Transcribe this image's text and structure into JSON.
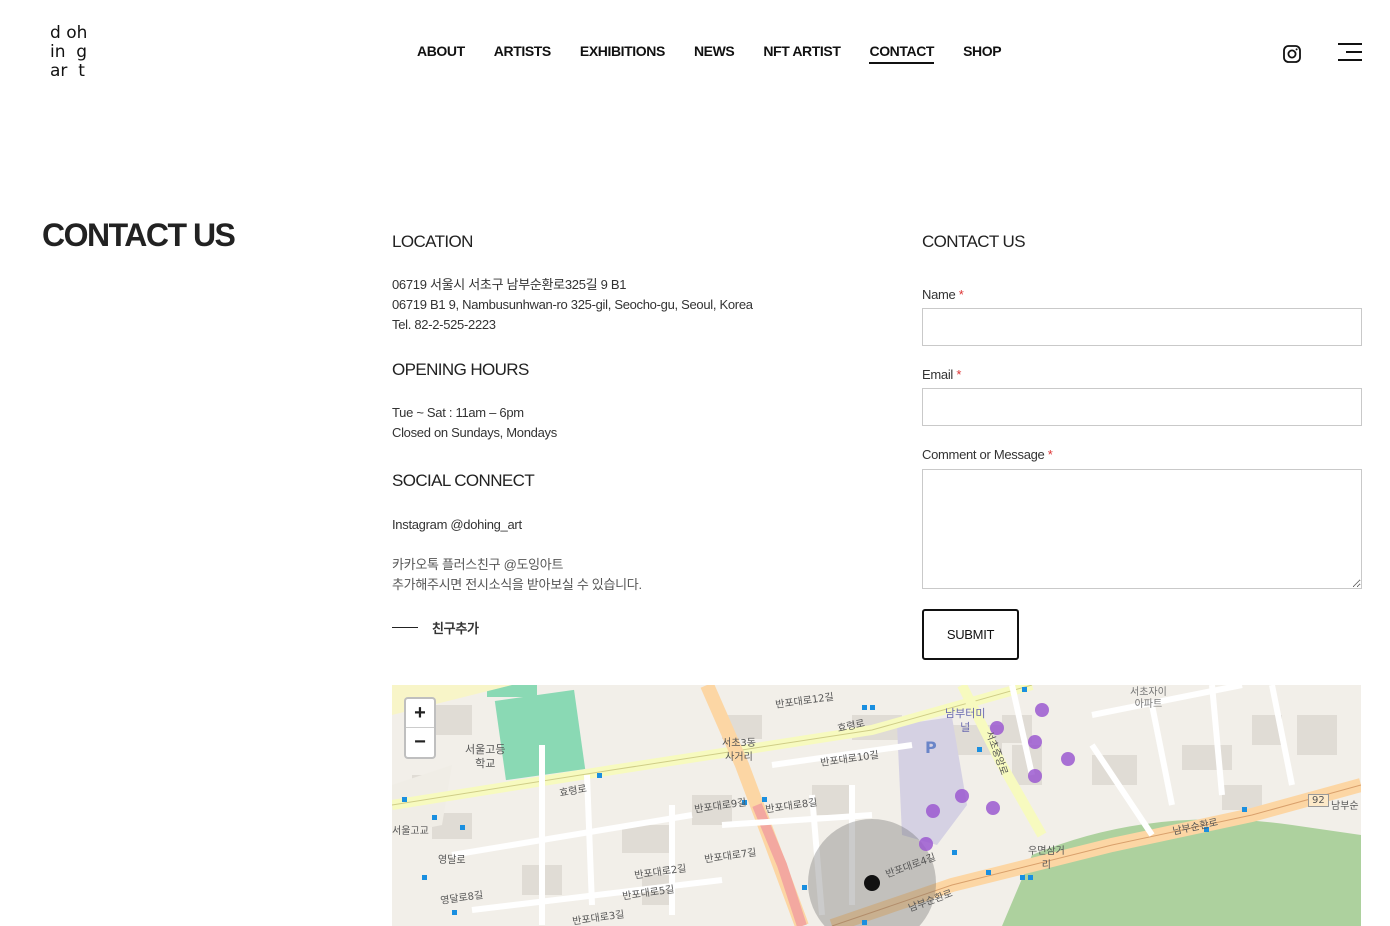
{
  "header": {
    "logo_lines": [
      "d oh",
      "in  g",
      "ar  t"
    ],
    "nav": [
      "ABOUT",
      "ARTISTS",
      "EXHIBITIONS",
      "NEWS",
      "NFT ARTIST",
      "CONTACT",
      "SHOP"
    ],
    "active_nav": "CONTACT"
  },
  "page_title": "CONTACT US",
  "location": {
    "heading": "LOCATION",
    "line1": "06719 서울시 서초구 남부순환로325길 9 B1",
    "line2": "06719 B1 9, Nambusunhwan-ro 325-gil, Seocho-gu, Seoul, Korea",
    "line3": "Tel. 82-2-525-2223"
  },
  "hours": {
    "heading": "OPENING HOURS",
    "line1": "Tue ~ Sat : 11am – 6pm",
    "line2": "Closed on Sundays, Mondays"
  },
  "social": {
    "heading": "SOCIAL CONNECT",
    "instagram": "Instagram @dohing_art",
    "kakao1": "카카오톡 플러스친구 @도잉아트",
    "kakao2": "추가해주시면 전시소식을 받아보실 수 있습니다.",
    "friend_add": "친구추가"
  },
  "form": {
    "heading": "CONTACT US",
    "name_label": "Name",
    "email_label": "Email",
    "message_label": "Comment or Message",
    "required_mark": "*",
    "name_value": "",
    "email_value": "",
    "message_value": "",
    "submit_label": "SUBMIT"
  },
  "map": {
    "zoom_in": "+",
    "zoom_out": "−",
    "labels": {
      "school": "서울고등\n학교",
      "seocho3": "서초3동\n사거리",
      "nambu_terminal": "남부터미\n널",
      "seocho_apt": "서초자이\n아파트",
      "umyeon": "우면삼거\n리",
      "route": "92",
      "nambu_short": "남부순",
      "hyoryeong_1": "효령로",
      "hyoryeong_2": "효령로",
      "nambusunhwan": "남부순환로",
      "nambusunhwan_2": "남부순환로",
      "banpo_12": "반포대로12길",
      "banpo_10": "반포대로10길",
      "banpo_9": "반포대로9길",
      "banpo_8": "반포대로8길",
      "banpo_7": "반포대로7길",
      "banpo_5": "반포대로5길",
      "banpo_3": "반포대로3길",
      "banpo_2": "반포대로2길",
      "banpo_4": "반포대로4길",
      "seoul_school": "서울고교",
      "yeongdal": "영달로",
      "yeongdal8": "영달로8길",
      "seocho_jungang": "서초중앙로"
    },
    "accent": "#e8a36a"
  }
}
